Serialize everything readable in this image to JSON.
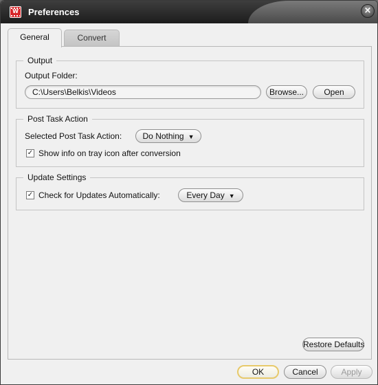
{
  "window": {
    "title": "Preferences",
    "app_icon": "app-logo-icon",
    "close_icon": "close-icon",
    "close_glyph": "×"
  },
  "tabs": [
    {
      "label": "General",
      "active": true
    },
    {
      "label": "Convert",
      "active": false
    }
  ],
  "output": {
    "group_title": "Output",
    "folder_label": "Output Folder:",
    "folder_value": "C:\\Users\\Belkis\\Videos",
    "browse_label": "Browse...",
    "open_label": "Open"
  },
  "post_task": {
    "group_title": "Post Task Action",
    "selected_label": "Selected Post Task Action:",
    "selected_value": "Do Nothing",
    "show_info_label": "Show info on tray icon after conversion",
    "show_info_checked": true
  },
  "updates": {
    "group_title": "Update Settings",
    "check_label": "Check for Updates Automatically:",
    "check_checked": true,
    "frequency_value": "Every Day"
  },
  "footer": {
    "restore_label": "Restore Defaults",
    "ok_label": "OK",
    "cancel_label": "Cancel",
    "apply_label": "Apply"
  },
  "glyphs": {
    "check": "✓",
    "caret": "▼"
  }
}
